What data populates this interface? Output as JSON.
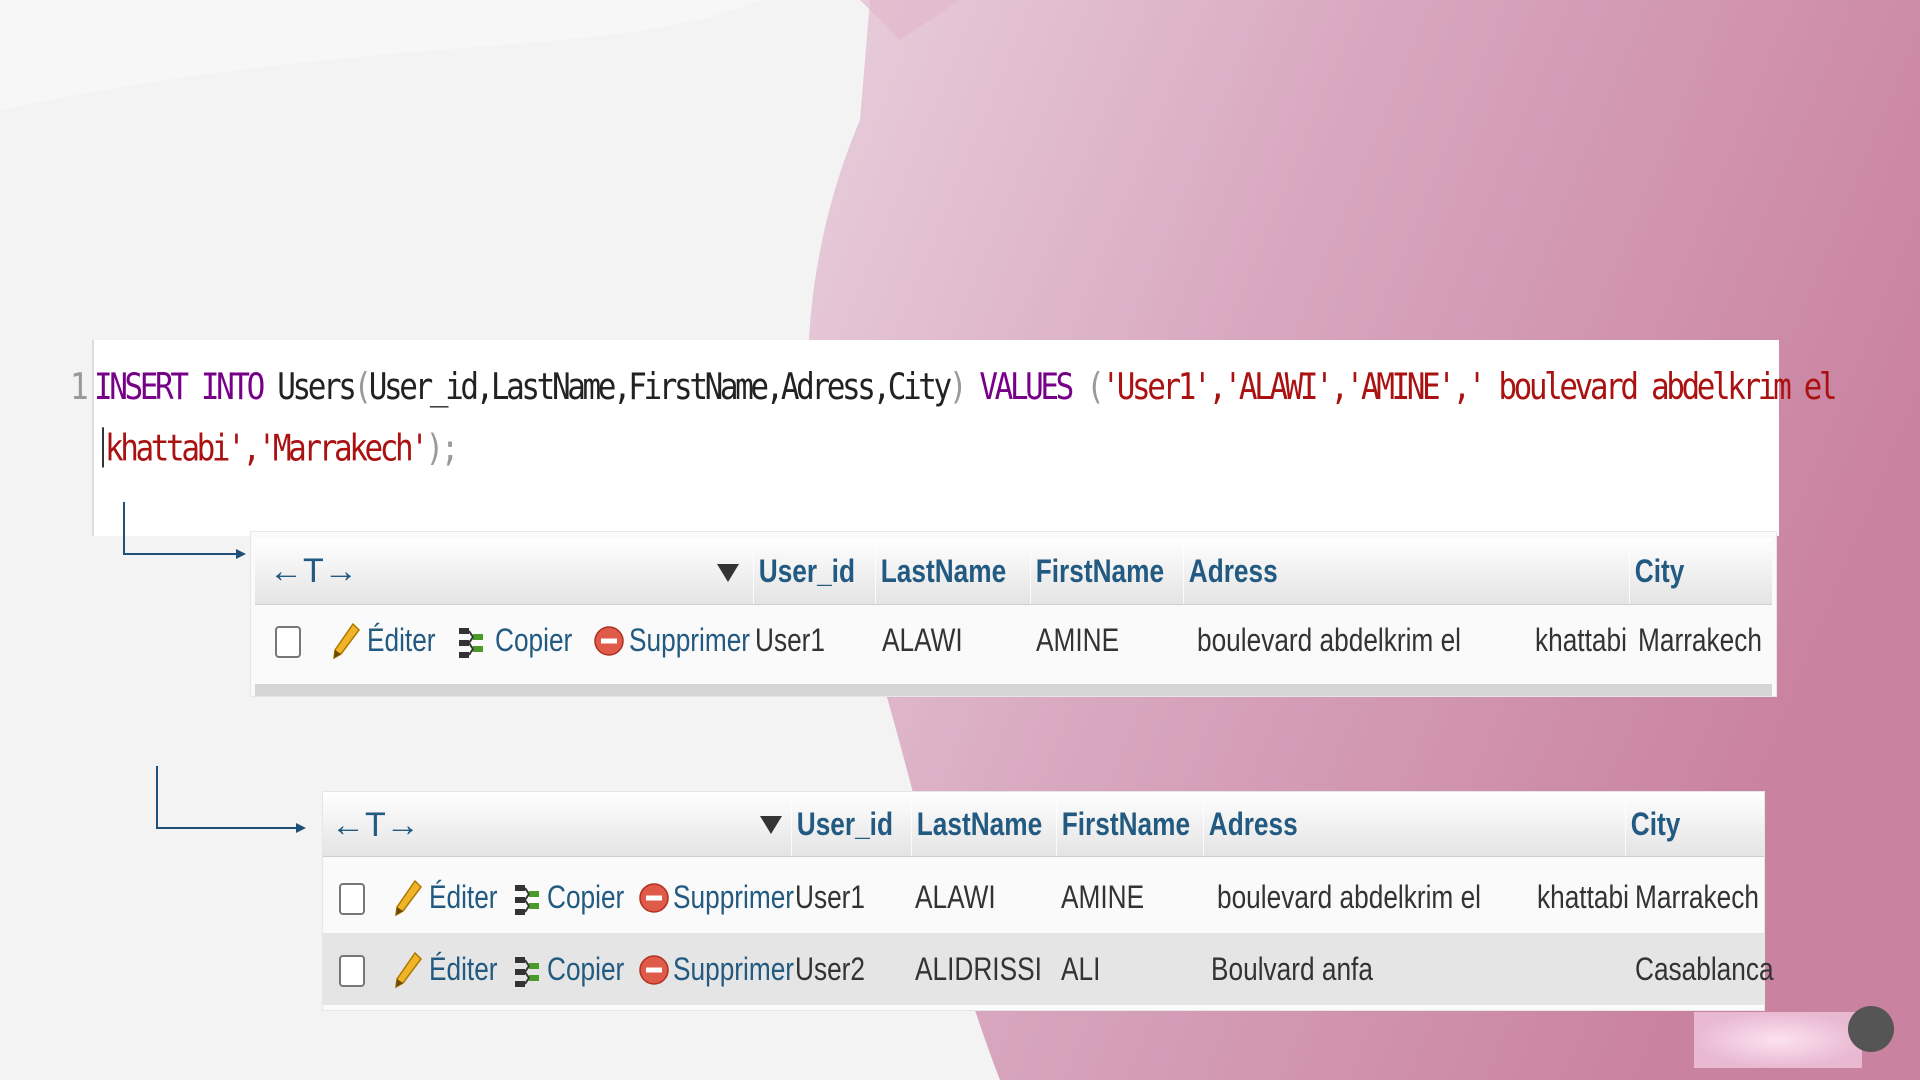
{
  "editor": {
    "line_number": "1",
    "kw_insert": "INSERT",
    "kw_into": "INTO",
    "table_cols": "Users",
    "open_paren": "(",
    "cols": "User_id,LastName,FirstName,Adress,City",
    "close_paren": ")",
    "kw_values": "VALUES",
    "values_open": "(",
    "values_line1": "'User1','ALAWI','AMINE',' boulevard abdelkrim el",
    "values_line2": "khattabi','Marrakech'",
    "values_close": ");"
  },
  "columns": {
    "nav": "←T→",
    "user_id": "User_id",
    "lastname": "LastName",
    "firstname": "FirstName",
    "adress": "Adress",
    "city": "City"
  },
  "actions": {
    "edit": "Éditer",
    "copy": "Copier",
    "delete": "Supprimer"
  },
  "table1": {
    "rows": [
      {
        "user_id": "User1",
        "lastname": "ALAWI",
        "firstname": "AMINE",
        "adress": "boulevard abdelkrim el",
        "adress_tail": "khattabi",
        "city": "Marrakech"
      }
    ]
  },
  "table2": {
    "rows": [
      {
        "user_id": "User1",
        "lastname": "ALAWI",
        "firstname": "AMINE",
        "adress": "boulevard abdelkrim el",
        "adress_tail": "khattabi",
        "city": "Marrakech"
      },
      {
        "user_id": "User2",
        "lastname": "ALIDRISSI",
        "firstname": "ALI",
        "adress": "Boulvard anfa",
        "adress_tail": "",
        "city": "Casablanca"
      }
    ]
  },
  "colors": {
    "background_light": "#f3f3f3",
    "background_pink": "#cf93ad",
    "header_text": "#235a81",
    "sql_keyword": "#770088",
    "sql_string": "#aa1111"
  }
}
